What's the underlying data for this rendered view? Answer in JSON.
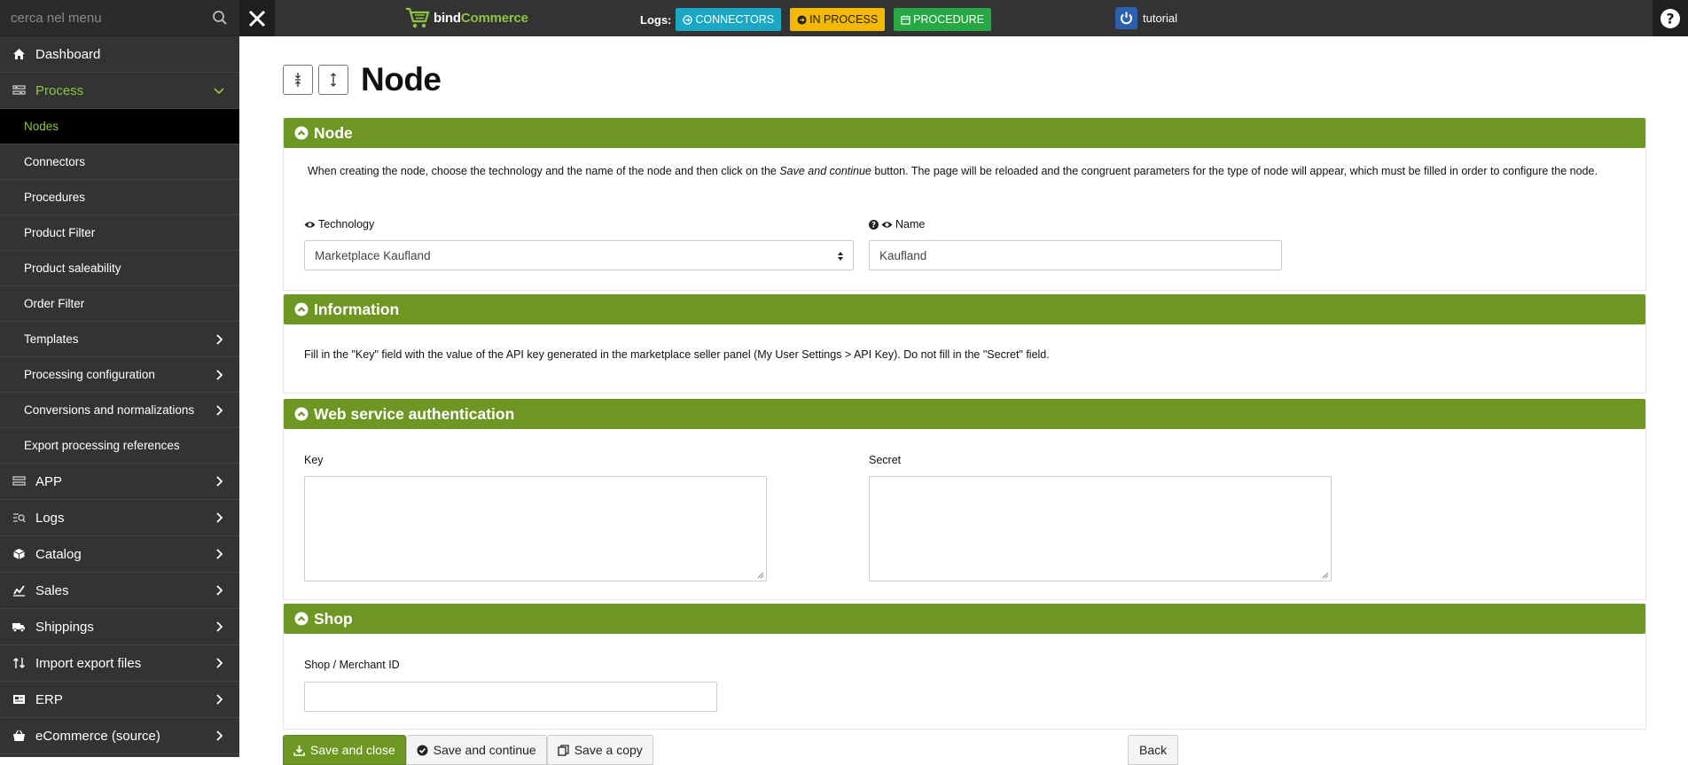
{
  "sidebar": {
    "search_placeholder": "cerca nel menu",
    "items": [
      {
        "label": "Dashboard",
        "icon": "home-icon"
      },
      {
        "label": "Process",
        "icon": "process-icon"
      },
      {
        "label": "APP",
        "icon": "app-icon"
      },
      {
        "label": "Logs",
        "icon": "logs-icon"
      },
      {
        "label": "Catalog",
        "icon": "catalog-icon"
      },
      {
        "label": "Sales",
        "icon": "sales-icon"
      },
      {
        "label": "Shippings",
        "icon": "truck-icon"
      },
      {
        "label": "Import export files",
        "icon": "import-export-icon"
      },
      {
        "label": "ERP",
        "icon": "erp-icon"
      },
      {
        "label": "eCommerce (source)",
        "icon": "basket-icon"
      }
    ],
    "sub_items": [
      {
        "label": "Nodes"
      },
      {
        "label": "Connectors"
      },
      {
        "label": "Procedures"
      },
      {
        "label": "Product Filter"
      },
      {
        "label": "Product saleability"
      },
      {
        "label": "Order Filter"
      },
      {
        "label": "Templates"
      },
      {
        "label": "Processing configuration"
      },
      {
        "label": "Conversions and normalizations"
      },
      {
        "label": "Export processing references"
      }
    ]
  },
  "topbar": {
    "brand_prefix": "bind",
    "brand_suffix": "Commerce",
    "logs_label": "Logs:",
    "badges": [
      {
        "label": "CONNECTORS",
        "color": "#1ba8c4"
      },
      {
        "label": "IN PROCESS",
        "color": "#f5b800"
      },
      {
        "label": "PROCEDURE",
        "color": "#28a745"
      }
    ],
    "user": "tutorial",
    "help": "?"
  },
  "page": {
    "title": "Node"
  },
  "sections": {
    "node": {
      "title": "Node",
      "desc_before": "When creating the node, choose the technology and the name of the node and then click on the ",
      "desc_em": "Save and continue",
      "desc_after": " button. The page will be reloaded and the congruent parameters for the type of node will appear, which must be filled in order to configure the node.",
      "technology_label": "Technology",
      "technology_value": "Marketplace Kaufland",
      "name_label": "Name",
      "name_value": "Kaufland"
    },
    "information": {
      "title": "Information",
      "text": "Fill in the \"Key\" field with the value of the API key generated in the marketplace seller panel (My User Settings > API Key). Do not fill in the \"Secret\" field."
    },
    "auth": {
      "title": "Web service authentication",
      "key_label": "Key",
      "secret_label": "Secret"
    },
    "shop": {
      "title": "Shop",
      "merchant_label": "Shop / Merchant ID"
    }
  },
  "footer": {
    "save_close": "Save and close",
    "save_continue": "Save and continue",
    "save_copy": "Save a copy",
    "back": "Back"
  },
  "colors": {
    "accent_green": "#6d9623",
    "menu_green": "#8cc63f",
    "sidebar_bg": "#333333"
  }
}
